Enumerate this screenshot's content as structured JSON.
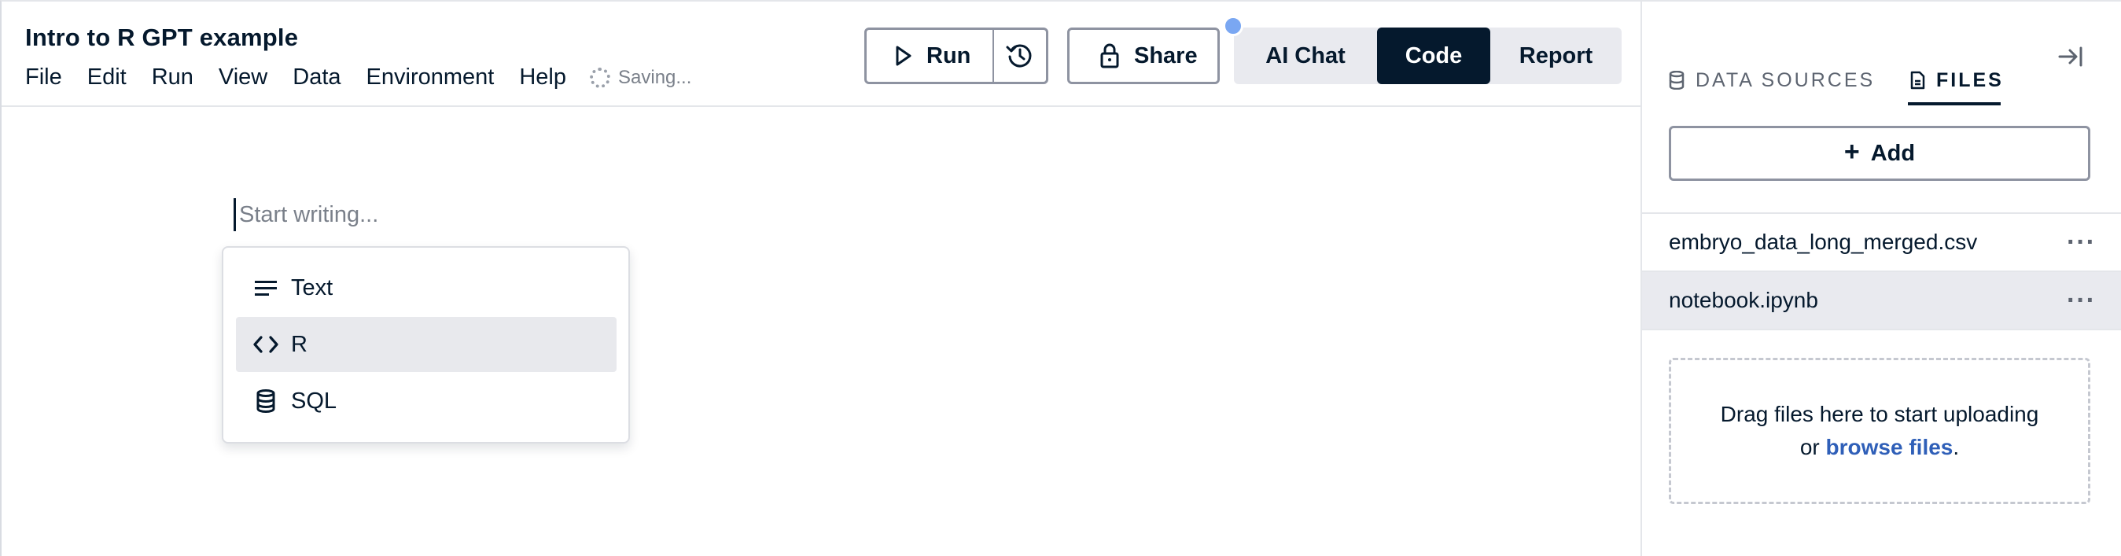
{
  "document": {
    "title": "Intro to R GPT example"
  },
  "menu": {
    "items": [
      "File",
      "Edit",
      "Run",
      "View",
      "Data",
      "Environment",
      "Help"
    ],
    "status": "Saving..."
  },
  "toolbar": {
    "run_label": "Run",
    "share_label": "Share",
    "modes": [
      {
        "label": "AI Chat",
        "active": false
      },
      {
        "label": "Code",
        "active": true
      },
      {
        "label": "Report",
        "active": false
      }
    ],
    "notification_dot_color": "#7aa7f2"
  },
  "editor": {
    "placeholder": "Start writing...",
    "insert_menu": [
      {
        "label": "Text",
        "icon": "text-lines-icon",
        "active": false
      },
      {
        "label": "R",
        "icon": "code-brackets-icon",
        "active": true
      },
      {
        "label": "SQL",
        "icon": "database-icon",
        "active": false
      }
    ]
  },
  "sidebar": {
    "tabs": [
      {
        "label": "DATA SOURCES",
        "icon": "database-icon",
        "active": false
      },
      {
        "label": "FILES",
        "icon": "file-icon",
        "active": true
      }
    ],
    "add_label": "Add",
    "files": [
      {
        "name": "embryo_data_long_merged.csv",
        "selected": false
      },
      {
        "name": "notebook.ipynb",
        "selected": true
      }
    ],
    "dropzone": {
      "line1": "Drag files here to start uploading",
      "line2_prefix": "or ",
      "link": "browse files",
      "line2_suffix": "."
    }
  },
  "colors": {
    "primary": "#05192d",
    "link": "#2f5fb8",
    "selected_bg": "#e9eaef"
  }
}
